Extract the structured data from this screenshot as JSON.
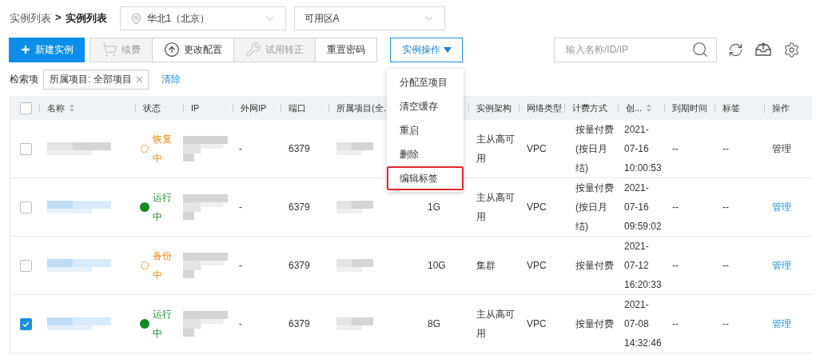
{
  "breadcrumb": {
    "parent": "实例列表",
    "separator": ">",
    "current": "实例列表"
  },
  "region_select": {
    "value": "华北1（北京）"
  },
  "zone_select": {
    "value": "可用区A"
  },
  "toolbar": {
    "buttons": [
      {
        "label": "新建实例",
        "kind": "plus",
        "primary": true,
        "disabled": false
      },
      {
        "label": "续费",
        "kind": "cart",
        "primary": false,
        "disabled": true
      },
      {
        "label": "更改配置",
        "kind": "arrow-up",
        "primary": false,
        "disabled": false
      },
      {
        "label": "试用转正",
        "kind": "tools",
        "primary": false,
        "disabled": true
      },
      {
        "label": "重置密码",
        "kind": "none",
        "primary": false,
        "disabled": false
      }
    ]
  },
  "actions_menu": {
    "label": "实例操作",
    "expanded": true,
    "items": [
      {
        "label": "分配至项目",
        "highlighted": false
      },
      {
        "label": "清空缓存",
        "highlighted": false
      },
      {
        "label": "重启",
        "highlighted": false
      },
      {
        "label": "删除",
        "highlighted": false
      },
      {
        "label": "编辑标签",
        "highlighted": true
      }
    ]
  },
  "search": {
    "placeholder": "输入名称/ID/IP"
  },
  "filter": {
    "label": "检索项",
    "tags": [
      {
        "text": "所属项目: 全部项目"
      }
    ],
    "clear": "清除"
  },
  "table": {
    "select_all_checked": false,
    "columns": [
      {
        "kind": "text",
        "label": "名称",
        "sortable": true
      },
      {
        "kind": "text",
        "label": "状态"
      },
      {
        "kind": "text",
        "label": "IP"
      },
      {
        "kind": "text",
        "label": "外网IP"
      },
      {
        "kind": "text",
        "label": "端口"
      },
      {
        "kind": "text",
        "label": "所属项目(全."
      },
      {
        "kind": "covered"
      },
      {
        "kind": "text",
        "label": "实例架构"
      },
      {
        "kind": "text",
        "label": "网络类型"
      },
      {
        "kind": "text",
        "label": "计费方式"
      },
      {
        "kind": "text",
        "label": "创...",
        "sortable": true
      },
      {
        "kind": "text",
        "label": "到期时间"
      },
      {
        "kind": "text",
        "label": "标签"
      },
      {
        "kind": "text",
        "label": "操作"
      }
    ],
    "rows": [
      {
        "checked": false,
        "disabled": true,
        "status": {
          "kind": "pending",
          "text": "恢复中"
        },
        "public_ip": "-",
        "port": "6379",
        "architecture": "主从高可用",
        "network": "VPC",
        "billing": "按量付费(按日月结)",
        "created": "2021-07-16 10:00:53",
        "expires": "--",
        "tags": "--",
        "action": "管理"
      },
      {
        "checked": false,
        "disabled": false,
        "status": {
          "kind": "running",
          "text": "运行中"
        },
        "public_ip": "-",
        "port": "6379",
        "capacity": "1G",
        "architecture": "主从高可用",
        "network": "VPC",
        "billing": "按量付费(按日月结)",
        "created": "2021-07-16 09:59:02",
        "expires": "--",
        "tags": "--",
        "action": "管理"
      },
      {
        "checked": false,
        "disabled": false,
        "status": {
          "kind": "pending",
          "text": "备份中"
        },
        "public_ip": "-",
        "port": "6379",
        "capacity": "10G",
        "architecture": "集群",
        "network": "VPC",
        "billing": "按量付费",
        "created": "2021-07-12 16:20:33",
        "expires": "--",
        "tags": "--",
        "action": "管理"
      },
      {
        "checked": true,
        "disabled": false,
        "status": {
          "kind": "running",
          "text": "运行中"
        },
        "public_ip": "-",
        "port": "6379",
        "capacity": "8G",
        "architecture": "主从高可用",
        "network": "VPC",
        "billing": "按量付费",
        "created": "2021-07-08 14:32:46",
        "expires": "--",
        "tags": "--",
        "action": "管理"
      }
    ]
  }
}
